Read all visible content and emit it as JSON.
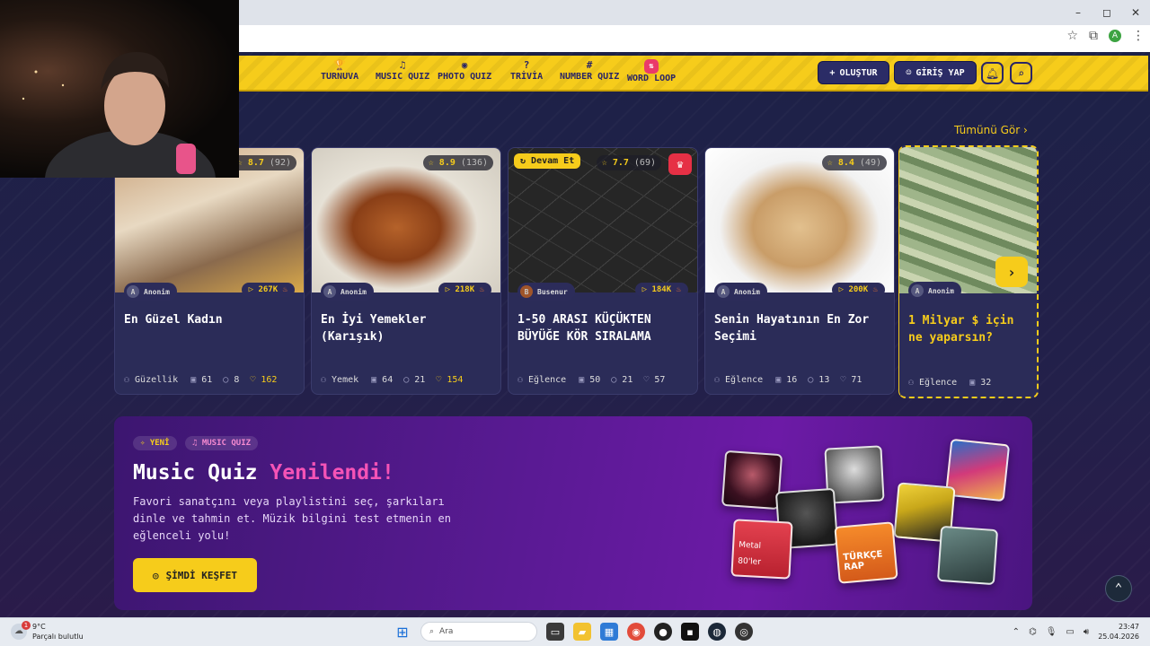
{
  "browser": {
    "window_controls": [
      "–",
      "◻",
      "✕"
    ],
    "profile_initial": "A"
  },
  "nav": {
    "items": [
      {
        "label": "TURNUVA",
        "icon": "🏆"
      },
      {
        "label": "MUSIC QUIZ",
        "icon": "♫"
      },
      {
        "label": "PHOTO QUIZ",
        "icon": "◉"
      },
      {
        "label": "TRİVİA",
        "icon": "?"
      },
      {
        "label": "NUMBER QUIZ",
        "icon": "#"
      },
      {
        "label": "WORD LOOP",
        "icon": "⇅"
      }
    ],
    "create_label": "OLUŞTUR",
    "login_label": "GİRİŞ YAP"
  },
  "see_all": "Tümünü Gör ›",
  "cards": [
    {
      "rating": "8.7",
      "votes": "(92)",
      "author": "Anonim",
      "author_initial": "A",
      "plays": "267K",
      "title": "En Güzel Kadın",
      "category": "Güzellik",
      "questions": "61",
      "comments": "8",
      "likes": "162",
      "liked": true
    },
    {
      "rating": "8.9",
      "votes": "(136)",
      "author": "Anonim",
      "author_initial": "A",
      "plays": "218K",
      "title": "En İyi Yemekler (Karışık)",
      "category": "Yemek",
      "questions": "64",
      "comments": "21",
      "likes": "154",
      "liked": true
    },
    {
      "rating": "7.7",
      "votes": "(69)",
      "author": "Busenur",
      "author_initial": "B",
      "plays": "184K",
      "title": "1-50 ARASI KÜÇÜKTEN BÜYÜĞE KÖR SIRALAMA",
      "category": "Eğlence",
      "questions": "50",
      "comments": "21",
      "likes": "57",
      "liked": false,
      "badge": "Devam Et"
    },
    {
      "rating": "8.4",
      "votes": "(49)",
      "author": "Anonim",
      "author_initial": "A",
      "plays": "200K",
      "title": "Senin Hayatının En Zor Seçimi",
      "category": "Eğlence",
      "questions": "16",
      "comments": "13",
      "likes": "71",
      "liked": false
    },
    {
      "author": "Anonim",
      "author_initial": "A",
      "title": "1 Milyar $ için ne yaparsın?",
      "category": "Eğlence",
      "questions": "32"
    }
  ],
  "banner": {
    "chip_new": "YENİ",
    "chip_music": "MUSIC QUIZ",
    "title_main": "Music Quiz",
    "title_highlight": "Yenilendi!",
    "description": "Favori sanatçını veya playlistini seç, şarkıları dinle ve tahmin et. Müzik bilgini test etmenin en eğlenceli yolu!",
    "cta_label": "ŞİMDİ KEŞFET",
    "tile_metal_top": "Metal",
    "tile_metal_bottom": "80'ler",
    "tile_rap": "TÜRKÇE RAP"
  },
  "taskbar": {
    "temp": "9°C",
    "weather": "Parçalı bulutlu",
    "weather_badge": "1",
    "search_placeholder": "Ara",
    "time": "23:47",
    "date": "25.04.2026"
  },
  "colors": {
    "accent": "#f6cc1b",
    "nav_text": "#2a2566",
    "highlight": "#f553b6",
    "banner": "#5a1a94"
  }
}
